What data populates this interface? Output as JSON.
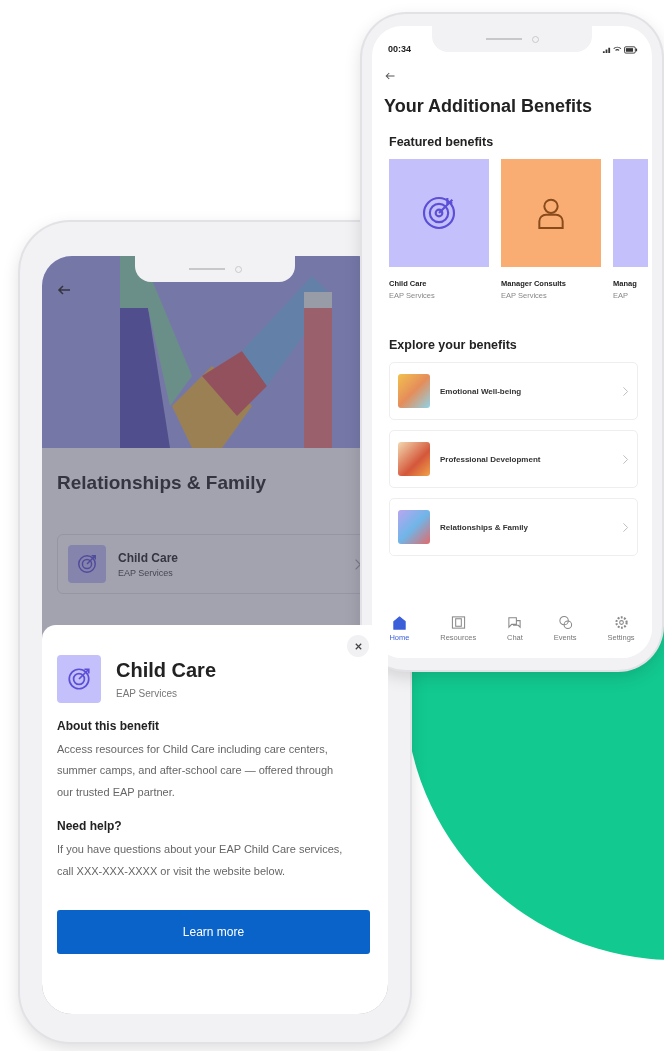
{
  "right_phone": {
    "status_bar": {
      "time": "00:34"
    },
    "title": "Your Additional Benefits",
    "featured": {
      "heading": "Featured benefits",
      "cards": [
        {
          "title": "Child Care",
          "subtitle": "EAP Services",
          "color": "#c4c0fb",
          "kind": "target"
        },
        {
          "title": "Manager Consults",
          "subtitle": "EAP Services",
          "color": "#f9ad72",
          "kind": "person"
        },
        {
          "title": "Manag",
          "subtitle": "EAP",
          "color": "#c4c0fb",
          "kind": "blank"
        }
      ]
    },
    "explore": {
      "heading": "Explore your benefits",
      "items": [
        {
          "label": "Emotional Well-being"
        },
        {
          "label": "Professional Development"
        },
        {
          "label": "Relationships & Family"
        }
      ]
    },
    "tab_bar": [
      {
        "label": "Home",
        "kind": "home",
        "selected": true
      },
      {
        "label": "Resources",
        "kind": "resources",
        "selected": false
      },
      {
        "label": "Chat",
        "kind": "chat",
        "selected": false
      },
      {
        "label": "Events",
        "kind": "events",
        "selected": false
      },
      {
        "label": "Settings",
        "kind": "settings",
        "selected": false
      }
    ]
  },
  "left_phone": {
    "title": "Relationships & Family",
    "items": [
      {
        "title": "Child Care",
        "subtitle": "EAP Services"
      }
    ],
    "sheet": {
      "open": true,
      "title": "Child Care",
      "subtitle": "EAP Services",
      "sections": [
        {
          "heading": "About this benefit",
          "body": "Access resources for Child Care including care centers, summer camps, and after-school care — offered through our trusted EAP partner."
        },
        {
          "heading": "Need help?",
          "body": "If you have questions about your EAP Child Care services, call XXX-XXX-XXXX or visit the website below."
        }
      ],
      "button": "Learn more"
    }
  }
}
